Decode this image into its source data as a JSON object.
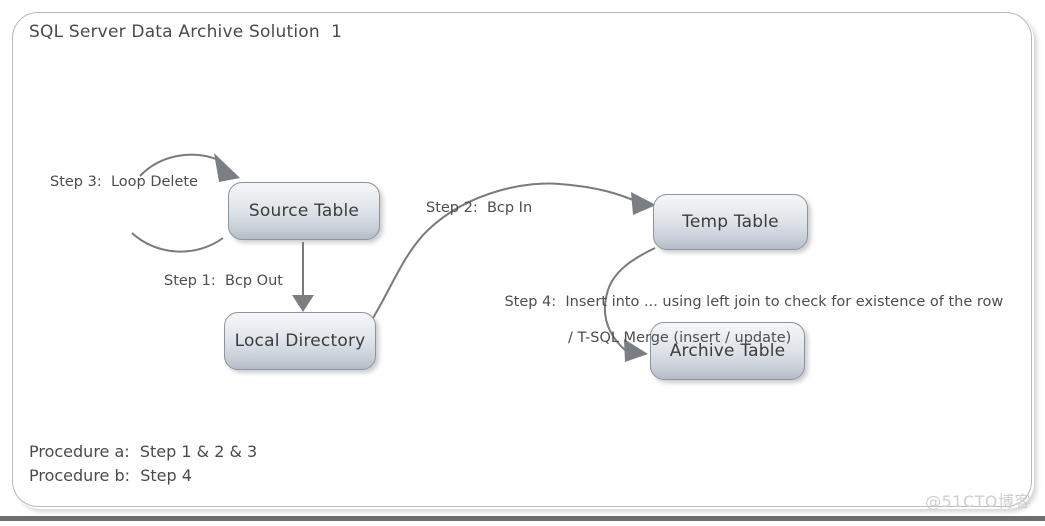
{
  "diagram": {
    "title": "SQL Server Data Archive Solution  1",
    "watermark": "@51CTO博客",
    "nodes": [
      {
        "id": "source-table",
        "label": "Source Table"
      },
      {
        "id": "local-directory",
        "label": "Local Directory"
      },
      {
        "id": "temp-table",
        "label": "Temp Table"
      },
      {
        "id": "archive-table",
        "label": "Archive Table"
      }
    ],
    "edge_labels": {
      "step3": "Step 3:  Loop Delete",
      "step1": "Step 1:  Bcp Out",
      "step2": "Step 2:  Bcp In",
      "step4_line1": "Step 4:  Insert into ... using left join to check for existence of the row",
      "step4_line2": "/ T-SQL Merge (insert / update)"
    },
    "procedures": [
      "Procedure a:  Step 1 & 2 & 3",
      "Procedure b:  Step 4"
    ],
    "colors": {
      "frame_border": "#b9b9b9",
      "node_border": "#8e949c",
      "node_fill_top": "#f4f6f8",
      "node_fill_bottom": "#b3bcc7",
      "connector": "#777b7e",
      "text": "#4a4a4a",
      "watermark": "#cfcfcf",
      "bottom_strip": "#6e6e6e"
    }
  }
}
